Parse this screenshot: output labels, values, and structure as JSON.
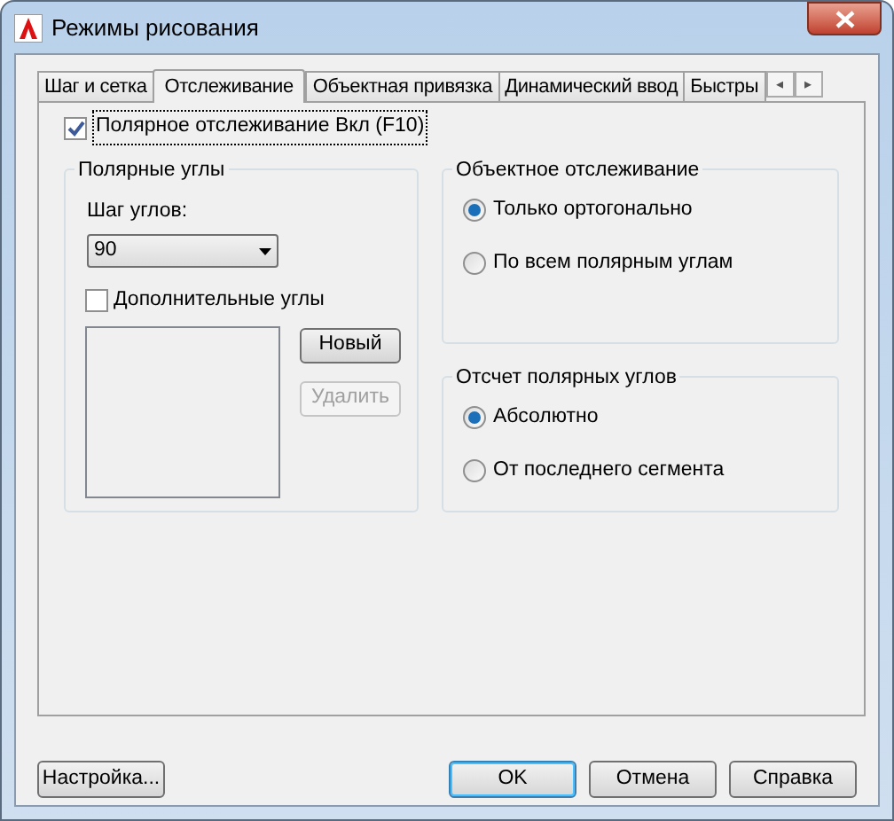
{
  "window": {
    "title": "Режимы рисования"
  },
  "tabs": [
    {
      "label": "Шаг и сетка",
      "selected": false
    },
    {
      "label": "Отслеживание",
      "selected": true
    },
    {
      "label": "Объектная привязка",
      "selected": false
    },
    {
      "label": "Динамический ввод",
      "selected": false
    },
    {
      "label": "Быстры",
      "selected": false
    }
  ],
  "tab_scroll": {
    "left": "◂",
    "right": "▸"
  },
  "polar_tracking": {
    "label": "Полярное отслеживание Вкл (F10)",
    "checked": true
  },
  "polar_angles": {
    "title": "Полярные углы",
    "step_label": "Шаг углов:",
    "step_value": "90",
    "additional": {
      "label": "Дополнительные углы",
      "checked": false
    },
    "new_button": {
      "label": "Новый",
      "disabled": false
    },
    "delete_button": {
      "label": "Удалить",
      "disabled": true
    }
  },
  "object_tracking": {
    "title": "Объектное отслеживание",
    "options": [
      {
        "label": "Только ортогонально",
        "selected": true
      },
      {
        "label": "По всем полярным углам",
        "selected": false
      }
    ]
  },
  "polar_measure": {
    "title": "Отсчет полярных углов",
    "options": [
      {
        "label": "Абсолютно",
        "selected": true
      },
      {
        "label": "От последнего сегмента",
        "selected": false
      }
    ]
  },
  "buttons": [
    {
      "label": "Настройка...",
      "kind": "left"
    },
    {
      "label": "OK",
      "kind": "default"
    },
    {
      "label": "Отмена",
      "kind": "normal"
    },
    {
      "label": "Справка",
      "kind": "normal"
    }
  ]
}
